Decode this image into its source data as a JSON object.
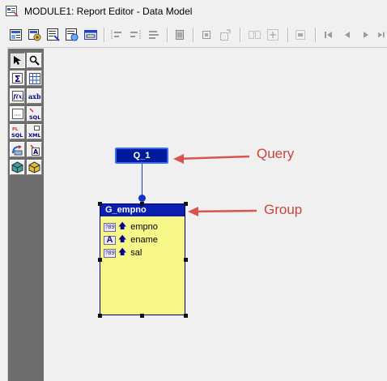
{
  "window": {
    "title": "MODULE1: Report Editor - Data Model"
  },
  "toolbar": {
    "buttons": [
      "report-wizard-icon",
      "data-wizard-icon",
      "run-paper-layout-icon",
      "run-web-layout-icon",
      "preview-icon",
      "move-forward-icon",
      "move-backward-icon",
      "align-icon",
      "object-properties-icon",
      "bring-front-icon",
      "send-back-icon",
      "group-icon",
      "ungroup-icon",
      "repeat-icon",
      "first-icon",
      "previous-icon",
      "next-icon",
      "last-icon"
    ]
  },
  "palette": {
    "tools": [
      {
        "name": "select-tool-icon",
        "glyph": "↖"
      },
      {
        "name": "magnify-tool-icon",
        "glyph": "🔍"
      },
      {
        "name": "summary-column-icon",
        "glyph": "Σ"
      },
      {
        "name": "cross-product-icon",
        "glyph": "▦"
      },
      {
        "name": "formula-column-icon",
        "glyph": "f(x)"
      },
      {
        "name": "placeholder-column-icon",
        "glyph": "axb"
      },
      {
        "name": "data-link-icon",
        "glyph": "⊟"
      },
      {
        "name": "sql-query-icon",
        "glyph": "SQL"
      },
      {
        "name": "plsql-query-icon",
        "glyph": "PL/SQL"
      },
      {
        "name": "xml-query-icon",
        "glyph": "XML"
      },
      {
        "name": "ref-cursor-icon",
        "glyph": "⤴"
      },
      {
        "name": "text-query-icon",
        "glyph": "A"
      },
      {
        "name": "jdbc-query-icon",
        "glyph": "◈"
      },
      {
        "name": "express-query-icon",
        "glyph": "◆"
      }
    ]
  },
  "data_model": {
    "query": {
      "name": "Q_1"
    },
    "group": {
      "name": "G_empno",
      "columns": [
        {
          "name": "empno",
          "type_badge": "?89"
        },
        {
          "name": "ename",
          "type_badge": "A"
        },
        {
          "name": "sal",
          "type_badge": "?89"
        }
      ]
    }
  },
  "annotations": {
    "query_label": "Query",
    "group_label": "Group",
    "arrow_color": "#d9534f"
  }
}
